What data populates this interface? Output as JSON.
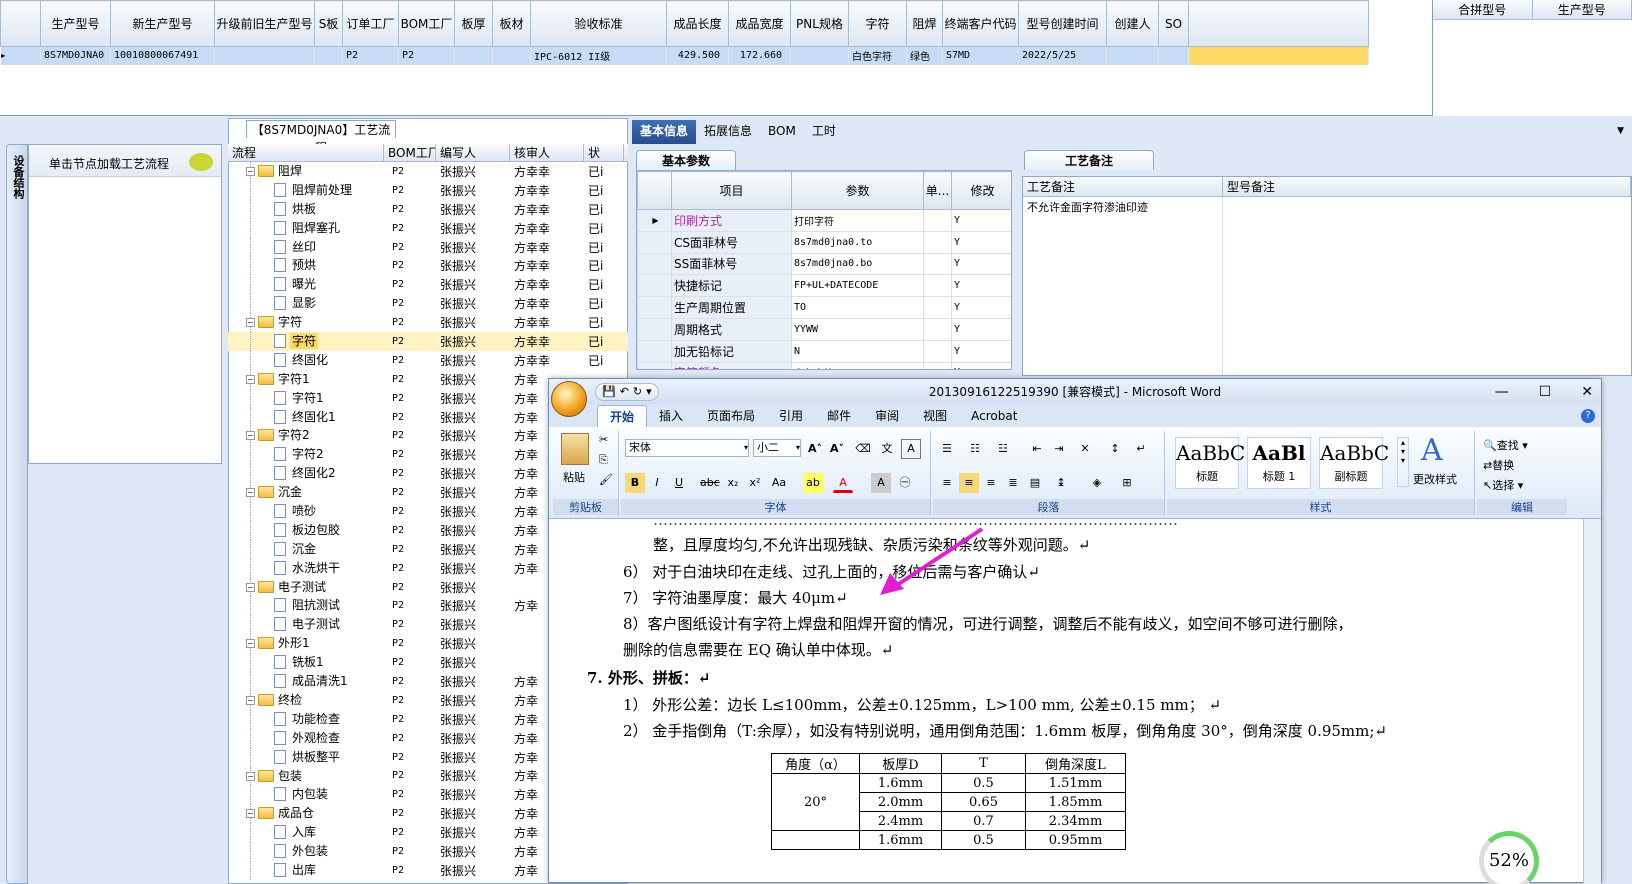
{
  "top_grid": {
    "columns": [
      "生产型号",
      "新生产型号",
      "升级前旧生产型号",
      "S板",
      "订单工厂",
      "BOM工厂",
      "板厚",
      "板材",
      "验收标准",
      "成品长度",
      "成品宽度",
      "PNL规格",
      "字符",
      "阻焊",
      "终端客户代码",
      "型号创建时间",
      "创建人",
      "SO"
    ],
    "row": [
      "8S7MD0JNA0",
      "10010800067491",
      "",
      "",
      "P2",
      "P2",
      "",
      "",
      "IPC-6012 II级",
      "429.500",
      "172.660",
      "",
      "白色字符",
      "绿色",
      "S7MD",
      "2022/5/25",
      "",
      ""
    ]
  },
  "right_grid": {
    "columns": [
      "合拼型号",
      "生产型号"
    ]
  },
  "side_tab": "设备结构",
  "left_panel": {
    "header": "单击节点加载工艺流程"
  },
  "process": {
    "title": "【8S7MD0JNA0】工艺流程",
    "columns": [
      "流程",
      "BOM工厂",
      "编写人",
      "核审人",
      "状"
    ],
    "rows": [
      {
        "n": "阻焊",
        "t": "f",
        "f": "P2",
        "w": "张振兴",
        "r": "方幸幸",
        "s": "已i"
      },
      {
        "n": "阻焊前处理",
        "t": "d",
        "f": "P2",
        "w": "张振兴",
        "r": "方幸幸",
        "s": "已i"
      },
      {
        "n": "烘板",
        "t": "d",
        "f": "P2",
        "w": "张振兴",
        "r": "方幸幸",
        "s": "已i"
      },
      {
        "n": "阻焊塞孔",
        "t": "d",
        "f": "P2",
        "w": "张振兴",
        "r": "方幸幸",
        "s": "已i"
      },
      {
        "n": "丝印",
        "t": "d",
        "f": "P2",
        "w": "张振兴",
        "r": "方幸幸",
        "s": "已i"
      },
      {
        "n": "预烘",
        "t": "d",
        "f": "P2",
        "w": "张振兴",
        "r": "方幸幸",
        "s": "已i"
      },
      {
        "n": "曝光",
        "t": "d",
        "f": "P2",
        "w": "张振兴",
        "r": "方幸幸",
        "s": "已i"
      },
      {
        "n": "显影",
        "t": "d",
        "f": "P2",
        "w": "张振兴",
        "r": "方幸幸",
        "s": "已i"
      },
      {
        "n": "字符",
        "t": "f",
        "f": "P2",
        "w": "张振兴",
        "r": "方幸幸",
        "s": "已i"
      },
      {
        "n": "字符",
        "t": "d",
        "f": "P2",
        "w": "张振兴",
        "r": "方幸幸",
        "s": "已i",
        "sel": true
      },
      {
        "n": "终固化",
        "t": "d",
        "f": "P2",
        "w": "张振兴",
        "r": "方幸幸",
        "s": "已i"
      },
      {
        "n": "字符1",
        "t": "f",
        "f": "P2",
        "w": "张振兴",
        "r": "方幸",
        "s": ""
      },
      {
        "n": "字符1",
        "t": "d",
        "f": "P2",
        "w": "张振兴",
        "r": "方幸",
        "s": ""
      },
      {
        "n": "终固化1",
        "t": "d",
        "f": "P2",
        "w": "张振兴",
        "r": "方幸",
        "s": ""
      },
      {
        "n": "字符2",
        "t": "f",
        "f": "P2",
        "w": "张振兴",
        "r": "方幸",
        "s": ""
      },
      {
        "n": "字符2",
        "t": "d",
        "f": "P2",
        "w": "张振兴",
        "r": "方幸",
        "s": ""
      },
      {
        "n": "终固化2",
        "t": "d",
        "f": "P2",
        "w": "张振兴",
        "r": "方幸",
        "s": ""
      },
      {
        "n": "沉金",
        "t": "f",
        "f": "P2",
        "w": "张振兴",
        "r": "方幸",
        "s": ""
      },
      {
        "n": "喷砂",
        "t": "d",
        "f": "P2",
        "w": "张振兴",
        "r": "方幸",
        "s": ""
      },
      {
        "n": "板边包胶",
        "t": "d",
        "f": "P2",
        "w": "张振兴",
        "r": "方幸",
        "s": ""
      },
      {
        "n": "沉金",
        "t": "d",
        "f": "P2",
        "w": "张振兴",
        "r": "方幸",
        "s": ""
      },
      {
        "n": "水洗烘干",
        "t": "d",
        "f": "P2",
        "w": "张振兴",
        "r": "方幸",
        "s": ""
      },
      {
        "n": "电子测试",
        "t": "f",
        "f": "P2",
        "w": "张振兴",
        "r": "",
        "s": ""
      },
      {
        "n": "阻抗测试",
        "t": "d",
        "f": "P2",
        "w": "张振兴",
        "r": "方幸",
        "s": ""
      },
      {
        "n": "电子测试",
        "t": "d",
        "f": "P2",
        "w": "张振兴",
        "r": "",
        "s": ""
      },
      {
        "n": "外形1",
        "t": "f",
        "f": "P2",
        "w": "张振兴",
        "r": "",
        "s": ""
      },
      {
        "n": "铣板1",
        "t": "d",
        "f": "P2",
        "w": "张振兴",
        "r": "",
        "s": ""
      },
      {
        "n": "成品清洗1",
        "t": "d",
        "f": "P2",
        "w": "张振兴",
        "r": "方幸",
        "s": ""
      },
      {
        "n": "终检",
        "t": "f",
        "f": "P2",
        "w": "张振兴",
        "r": "方幸",
        "s": ""
      },
      {
        "n": "功能检查",
        "t": "d",
        "f": "P2",
        "w": "张振兴",
        "r": "方幸",
        "s": ""
      },
      {
        "n": "外观检查",
        "t": "d",
        "f": "P2",
        "w": "张振兴",
        "r": "方幸",
        "s": ""
      },
      {
        "n": "烘板整平",
        "t": "d",
        "f": "P2",
        "w": "张振兴",
        "r": "方幸",
        "s": ""
      },
      {
        "n": "包装",
        "t": "f",
        "f": "P2",
        "w": "张振兴",
        "r": "方幸",
        "s": ""
      },
      {
        "n": "内包装",
        "t": "d",
        "f": "P2",
        "w": "张振兴",
        "r": "方幸",
        "s": ""
      },
      {
        "n": "成品仓",
        "t": "f",
        "f": "P2",
        "w": "张振兴",
        "r": "方幸",
        "s": ""
      },
      {
        "n": "入库",
        "t": "d",
        "f": "P2",
        "w": "张振兴",
        "r": "方幸",
        "s": ""
      },
      {
        "n": "外包装",
        "t": "d",
        "f": "P2",
        "w": "张振兴",
        "r": "方幸",
        "s": ""
      },
      {
        "n": "出库",
        "t": "d",
        "f": "P2",
        "w": "张振兴",
        "r": "方幸",
        "s": ""
      }
    ]
  },
  "info_tabs": [
    "基本信息",
    "拓展信息",
    "BOM",
    "工时"
  ],
  "basic_params": {
    "tab": "基本参数",
    "columns": [
      "项目",
      "参数",
      "单...",
      "修改"
    ],
    "rows": [
      {
        "k": "印刷方式",
        "v": "打印字符",
        "u": "",
        "m": "Y",
        "mag": true
      },
      {
        "k": "CS面菲林号",
        "v": "8s7md0jna0.to",
        "u": "",
        "m": "Y"
      },
      {
        "k": "SS面菲林号",
        "v": "8s7md0jna0.bo",
        "u": "",
        "m": "Y"
      },
      {
        "k": "快捷标记",
        "v": "FP+UL+DATECODE",
        "u": "",
        "m": "Y"
      },
      {
        "k": "生产周期位置",
        "v": "TO",
        "u": "",
        "m": "Y"
      },
      {
        "k": "周期格式",
        "v": "YYWW",
        "u": "",
        "m": "Y"
      },
      {
        "k": "加无铅标记",
        "v": "N",
        "u": "",
        "m": "Y"
      },
      {
        "k": "字符颜色",
        "v": "白色字符",
        "u": "",
        "m": "Y",
        "mag": true
      }
    ]
  },
  "remarks": {
    "tab": "工艺备注",
    "columns": [
      "工艺备注",
      "型号备注"
    ],
    "process_note": "不允许金面字符渗油印迹",
    "model_note": ""
  },
  "word": {
    "title": "20130916122519390 [兼容模式] - Microsoft Word",
    "tabs": [
      "开始",
      "插入",
      "页面布局",
      "引用",
      "邮件",
      "审阅",
      "视图",
      "Acrobat"
    ],
    "font": "宋体",
    "size": "小二",
    "groups": [
      "剪贴板",
      "字体",
      "段落",
      "样式",
      "编辑"
    ],
    "paste": "粘贴",
    "styles": [
      {
        "p": "AaBbC",
        "n": "标题"
      },
      {
        "p": "AaBl",
        "n": "标题 1"
      },
      {
        "p": "AaBbC",
        "n": "副标题"
      }
    ],
    "change_styles": "更改样式",
    "edit": [
      "查找",
      "替换",
      "选择"
    ],
    "lines": [
      "整，且厚度均匀,不允许出现残缺、杂质污染和条纹等外观问题。↵",
      "6） 对于白油块印在走线、过孔上面的，移位后需与客户确认↵",
      "7） 字符油墨厚度：最大 40μm↵",
      "8）客户图纸设计有字符上焊盘和阻焊开窗的情况，可进行调整，调整后不能有歧义，如空间不够可进行删除，",
      "删除的信息需要在 EQ 确认单中体现。↵",
      "7.   外形、拼板：↵",
      "1） 外形公差：边长 L≤100mm，公差±0.125mm，L>100  mm, 公差±0.15  mm；  ↵",
      "2） 金手指倒角（T:余厚），如没有特别说明，通用倒角范围：1.6mm 板厚，倒角角度 30°，倒角深度 0.95mm;↵"
    ],
    "table": {
      "head": [
        "角度（α）",
        "板厚D",
        "T",
        "倒角深度L"
      ],
      "angle": "20°",
      "rows": [
        [
          "1.6mm",
          "0.5",
          "1.51mm"
        ],
        [
          "2.0mm",
          "0.65",
          "1.85mm"
        ],
        [
          "2.4mm",
          "0.7",
          "2.34mm"
        ],
        [
          "1.6mm",
          "0.5",
          "0.95mm"
        ]
      ]
    },
    "progress": "52%",
    "colors": {
      "arrow": "#e020d0",
      "tab_active": "#15428b"
    }
  }
}
